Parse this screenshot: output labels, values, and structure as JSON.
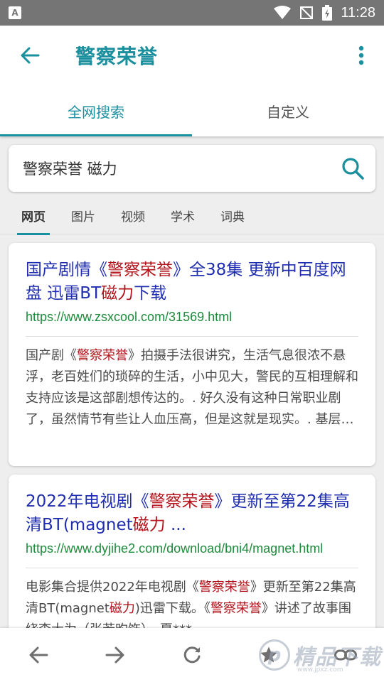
{
  "status_bar": {
    "notification_icon": "A",
    "time": "11:28"
  },
  "app_bar": {
    "title": "警察荣誉",
    "back_icon": "arrow-back-icon",
    "more_icon": "more-vert-icon"
  },
  "colors": {
    "accent": "#1a8f9e",
    "title_link": "#1f2db0",
    "highlight": "#b3121a",
    "url": "#1f8a3c"
  },
  "top_tabs": [
    {
      "label": "全网搜索",
      "active": true
    },
    {
      "label": "自定义",
      "active": false
    }
  ],
  "search": {
    "value": "警察荣誉 磁力"
  },
  "sub_tabs": [
    {
      "label": "网页",
      "active": true
    },
    {
      "label": "图片"
    },
    {
      "label": "视频"
    },
    {
      "label": "学术"
    },
    {
      "label": "词典"
    }
  ],
  "results": [
    {
      "title_parts": [
        "国产剧情《",
        "警察荣誉",
        "》全38集 更新中百度网盘 迅雷BT",
        "磁力",
        "下载"
      ],
      "url": "https://www.zsxcool.com/31569.html",
      "snippet_parts": [
        "国产剧《",
        "警察荣誉",
        "》拍摄手法很讲究，生活气息很浓不悬浮，老百姓们的琐碎的生活，小中见大，警民的互相理解和支持应该是这部剧想传达的。. 好久没有这种日常职业剧了，虽然情节有些让人血压高，但是这就是现实。. 基层民警的纷乱复杂，普通警察的日常……"
      ]
    },
    {
      "title_parts": [
        "2022年电视剧《",
        "警察荣誉",
        "》更新至第22集高清BT(magnet",
        "磁力",
        " ..."
      ],
      "url": "https://www.dyjihe2.com/download/bni4/magnet.html",
      "snippet_parts": [
        "电影集合提供2022年电视剧《",
        "警察荣誉",
        "》更新至第22集高清BT(magnet",
        "磁力",
        ")迅雷下载。《",
        "警察荣誉",
        "》讲述了故事围绕李大为（张若昀饰）、夏***"
      ]
    }
  ],
  "bottom_nav": [
    {
      "name": "nav-back-icon"
    },
    {
      "name": "nav-forward-icon"
    },
    {
      "name": "refresh-icon"
    },
    {
      "name": "star-icon"
    },
    {
      "name": "link-icon"
    }
  ],
  "watermark": {
    "text": "精品下载",
    "sub": "www.jpxz.com"
  }
}
